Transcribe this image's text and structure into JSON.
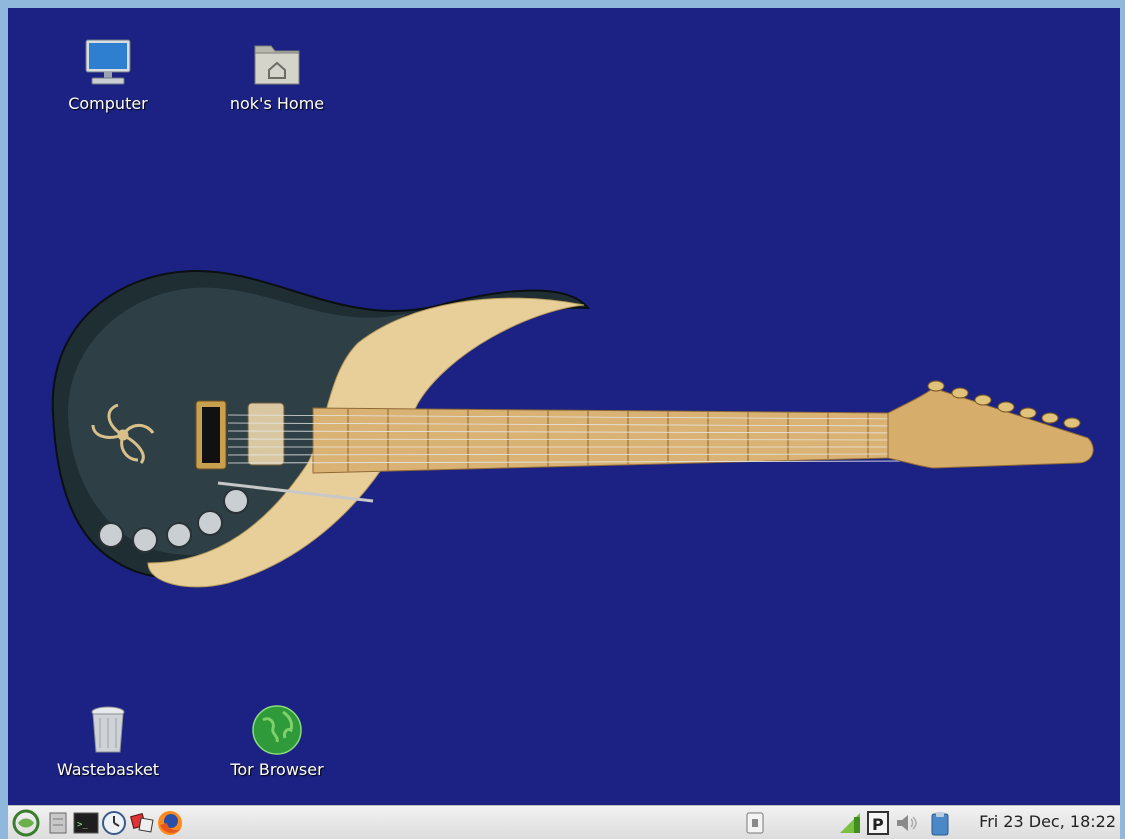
{
  "desktop": {
    "icons": [
      {
        "label": "Computer"
      },
      {
        "label": "nok's Home"
      },
      {
        "label": "Wastebasket"
      },
      {
        "label": "Tor Browser"
      }
    ]
  },
  "panel": {
    "launchers": [
      "menu-icon",
      "files-icon",
      "terminal-icon",
      "clock-app-icon",
      "games-icon",
      "firefox-icon"
    ],
    "tray": [
      "window-list-icon",
      "network-icon",
      "parking-icon",
      "volume-icon",
      "clipboard-icon"
    ],
    "clock": "Fri 23 Dec, 18:22"
  },
  "colors": {
    "desktop": "#1b2284",
    "border": "#8fb8dc",
    "panel": "#e6e6e6"
  }
}
